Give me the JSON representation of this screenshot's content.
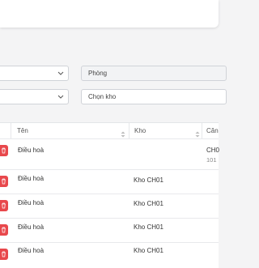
{
  "filters": {
    "room_select_value": "Phòng",
    "warehouse_select_value": "Chọn kho"
  },
  "table": {
    "headers": {
      "name": "Tên",
      "warehouse": "Kho",
      "next": "Căn"
    },
    "rows": [
      {
        "name": "Điều hoà",
        "warehouse": "",
        "apartment": "CH0",
        "apartment_sub": "101"
      },
      {
        "name": "Điều hoà",
        "warehouse": "Kho CH01",
        "apartment": "",
        "apartment_sub": ""
      },
      {
        "name": "Điều hoà",
        "warehouse": "Kho CH01",
        "apartment": "",
        "apartment_sub": ""
      },
      {
        "name": "Điều hoà",
        "warehouse": "Kho CH01",
        "apartment": "",
        "apartment_sub": ""
      },
      {
        "name": "Điều hoà",
        "warehouse": "Kho CH01",
        "apartment": "",
        "apartment_sub": ""
      }
    ]
  },
  "colors": {
    "delete": "#e8484c",
    "accent_border": "#d0d3d8"
  }
}
